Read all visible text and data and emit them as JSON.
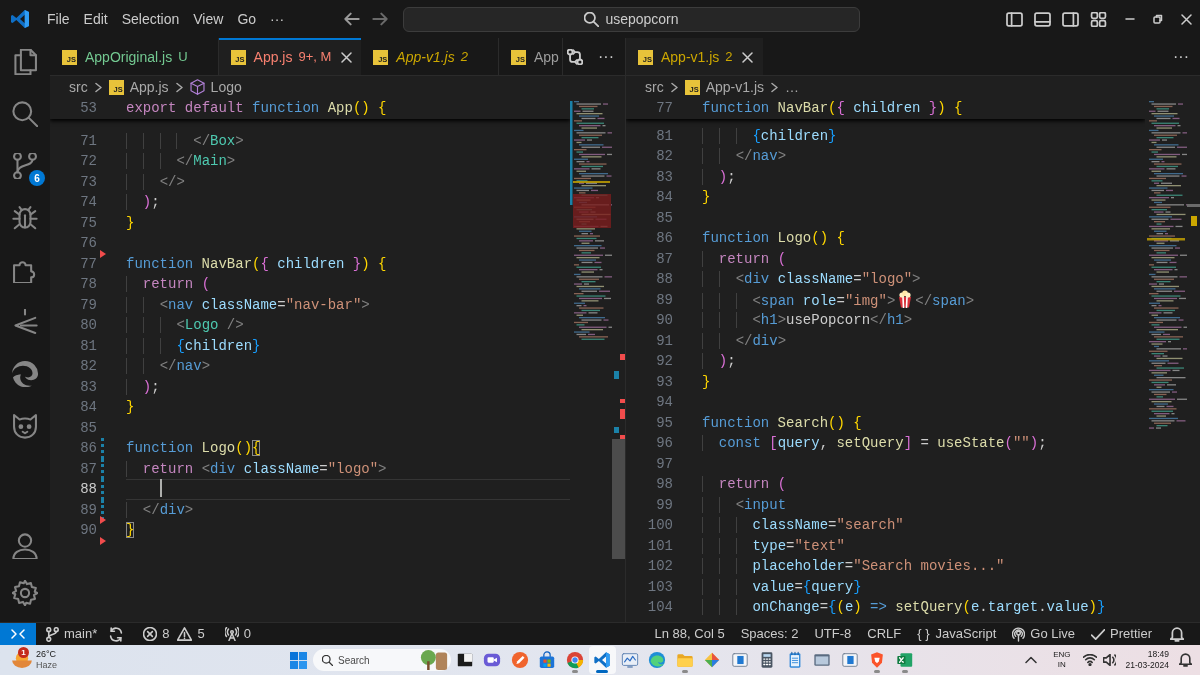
{
  "title_bar": {
    "menu": [
      "File",
      "Edit",
      "Selection",
      "View",
      "Go",
      "···"
    ],
    "command_center": "usepopcorn"
  },
  "activity_bar": {
    "items": [
      {
        "kind": "explorer"
      },
      {
        "kind": "search"
      },
      {
        "kind": "source_control",
        "badge": "6"
      },
      {
        "kind": "debug"
      },
      {
        "kind": "extensions"
      },
      {
        "kind": "arrow"
      },
      {
        "kind": "swirl"
      },
      {
        "kind": "cat"
      }
    ],
    "bottom": [
      {
        "kind": "account"
      },
      {
        "kind": "settings"
      }
    ]
  },
  "editors": [
    {
      "focused": true,
      "tabs": [
        {
          "icon_text": "JS",
          "name": "AppOriginal.js",
          "decoration": "U",
          "color": "#73c991",
          "selected": false,
          "preview": false
        },
        {
          "icon_text": "JS",
          "name": "App.js",
          "decoration": "9+, M",
          "color": "#f88070",
          "selected": true,
          "preview": false
        },
        {
          "icon_text": "JS",
          "name": "App-v1.js",
          "decoration": "2",
          "color": "#cca700",
          "selected": false,
          "preview": true
        },
        {
          "icon_text": "JS",
          "name": "App",
          "color": "#9d9d9d",
          "selected": false,
          "preview": false
        }
      ],
      "actions": [
        {
          "kind": "compare"
        },
        {
          "kind": "more",
          "label": "···"
        }
      ],
      "breadcrumbs": [
        {
          "kind": "folder",
          "label": "src"
        },
        {
          "kind": "file",
          "icon_text": "JS",
          "label": "App.js"
        },
        {
          "kind": "symbol",
          "label": "Logo"
        }
      ],
      "sticky_line": {
        "number": "53",
        "tokens": [
          {
            "text": "export",
            "kind": "keyword"
          },
          {
            "text": " default",
            "kind": "keyword"
          },
          {
            "text": " function",
            "kind": "storage"
          },
          {
            "text": " App",
            "kind": "function"
          },
          {
            "text": "()",
            "kind": "bracket1"
          },
          {
            "text": " {",
            "kind": "bracket1"
          }
        ]
      },
      "lines": [
        {
          "number": "71",
          "current": false,
          "modified": false,
          "deleted": false,
          "tokens": [
            {
              "text": "        </",
              "kind": "punct"
            },
            {
              "text": "Box",
              "kind": "component"
            },
            {
              "text": ">",
              "kind": "punct"
            }
          ]
        },
        {
          "number": "72",
          "current": false,
          "modified": false,
          "deleted": false,
          "tokens": [
            {
              "text": "      </",
              "kind": "punct"
            },
            {
              "text": "Main",
              "kind": "component"
            },
            {
              "text": ">",
              "kind": "punct"
            }
          ]
        },
        {
          "number": "73",
          "current": false,
          "modified": false,
          "deleted": false,
          "tokens": [
            {
              "text": "    </>",
              "kind": "punct"
            }
          ]
        },
        {
          "number": "74",
          "current": false,
          "modified": false,
          "deleted": false,
          "tokens": [
            {
              "text": "  )",
              "kind": "bracket2"
            },
            {
              "text": ";",
              "kind": "plain"
            }
          ]
        },
        {
          "number": "75",
          "current": false,
          "modified": false,
          "deleted": false,
          "tokens": [
            {
              "text": "}",
              "kind": "bracket1"
            }
          ]
        },
        {
          "number": "76",
          "current": false,
          "modified": false,
          "deleted": true
        },
        {
          "number": "77",
          "current": false,
          "modified": false,
          "deleted": false,
          "tokens": [
            {
              "text": "function",
              "kind": "storage"
            },
            {
              "text": " NavBar",
              "kind": "function"
            },
            {
              "text": "(",
              "kind": "bracket1"
            },
            {
              "text": "{",
              "kind": "bracket2"
            },
            {
              "text": " children",
              "kind": "variable"
            },
            {
              "text": " }",
              "kind": "bracket2"
            },
            {
              "text": ")",
              "kind": "bracket1"
            },
            {
              "text": " {",
              "kind": "bracket1"
            }
          ]
        },
        {
          "number": "78",
          "current": false,
          "modified": false,
          "deleted": false,
          "tokens": [
            {
              "text": "  return",
              "kind": "keyword"
            },
            {
              "text": " (",
              "kind": "bracket2"
            }
          ]
        },
        {
          "number": "79",
          "current": false,
          "modified": false,
          "deleted": false,
          "tokens": [
            {
              "text": "    <",
              "kind": "punct"
            },
            {
              "text": "nav",
              "kind": "tag"
            },
            {
              "text": " className",
              "kind": "attr"
            },
            {
              "text": "=",
              "kind": "plain"
            },
            {
              "text": "\"nav-bar\"",
              "kind": "string"
            },
            {
              "text": ">",
              "kind": "punct"
            }
          ]
        },
        {
          "number": "80",
          "current": false,
          "modified": false,
          "deleted": false,
          "tokens": [
            {
              "text": "      <",
              "kind": "punct"
            },
            {
              "text": "Logo",
              "kind": "component"
            },
            {
              "text": " />",
              "kind": "punct"
            }
          ]
        },
        {
          "number": "81",
          "current": false,
          "modified": false,
          "deleted": false,
          "tokens": [
            {
              "text": "      {",
              "kind": "bracket3"
            },
            {
              "text": "children",
              "kind": "variable"
            },
            {
              "text": "}",
              "kind": "bracket3"
            }
          ]
        },
        {
          "number": "82",
          "current": false,
          "modified": false,
          "deleted": false,
          "tokens": [
            {
              "text": "    </",
              "kind": "punct"
            },
            {
              "text": "nav",
              "kind": "tag"
            },
            {
              "text": ">",
              "kind": "punct"
            }
          ]
        },
        {
          "number": "83",
          "current": false,
          "modified": false,
          "deleted": false,
          "tokens": [
            {
              "text": "  )",
              "kind": "bracket2"
            },
            {
              "text": ";",
              "kind": "plain"
            }
          ]
        },
        {
          "number": "84",
          "current": false,
          "modified": false,
          "deleted": false,
          "tokens": [
            {
              "text": "}",
              "kind": "bracket1"
            }
          ]
        },
        {
          "number": "85",
          "current": false,
          "modified": false,
          "deleted": false
        },
        {
          "number": "86",
          "current": false,
          "modified": true,
          "deleted": false,
          "tokens": [
            {
              "text": "function",
              "kind": "storage"
            },
            {
              "text": " Logo",
              "kind": "function"
            },
            {
              "text": "()",
              "kind": "bracket1"
            },
            {
              "text": "{",
              "kind": "matched"
            }
          ]
        },
        {
          "number": "87",
          "current": false,
          "modified": true,
          "deleted": false,
          "tokens": [
            {
              "text": "  return",
              "kind": "keyword"
            },
            {
              "text": " <",
              "kind": "punct"
            },
            {
              "text": "div",
              "kind": "tag"
            },
            {
              "text": " className",
              "kind": "attr"
            },
            {
              "text": "=",
              "kind": "plain"
            },
            {
              "text": "\"logo\"",
              "kind": "string"
            },
            {
              "text": ">",
              "kind": "punct"
            }
          ]
        },
        {
          "number": "88",
          "current": true,
          "modified": true,
          "deleted": false
        },
        {
          "number": "89",
          "current": false,
          "modified": true,
          "deleted": true,
          "tokens": [
            {
              "text": "  </",
              "kind": "punct"
            },
            {
              "text": "div",
              "kind": "tag"
            },
            {
              "text": ">",
              "kind": "punct"
            }
          ]
        },
        {
          "number": "90",
          "current": false,
          "modified": false,
          "deleted": true,
          "tokens": [
            {
              "text": "}",
              "kind": "matched"
            }
          ]
        }
      ]
    },
    {
      "focused": false,
      "tabs": [
        {
          "icon_text": "JS",
          "name": "App-v1.js",
          "decoration": "2",
          "color": "#cca700",
          "selected": true,
          "preview": false
        }
      ],
      "actions": [
        {
          "kind": "more",
          "label": "···"
        }
      ],
      "breadcrumbs": [
        {
          "kind": "folder",
          "label": "src"
        },
        {
          "kind": "file",
          "icon_text": "JS",
          "label": "App-v1.js"
        },
        {
          "kind": "more",
          "label": "…"
        }
      ],
      "sticky_line": {
        "number": "77",
        "tokens": [
          {
            "text": "function",
            "kind": "storage"
          },
          {
            "text": " NavBar",
            "kind": "function"
          },
          {
            "text": "(",
            "kind": "bracket1"
          },
          {
            "text": "{",
            "kind": "bracket2"
          },
          {
            "text": " children",
            "kind": "variable"
          },
          {
            "text": " }",
            "kind": "bracket2"
          },
          {
            "text": ")",
            "kind": "bracket1"
          },
          {
            "text": " {",
            "kind": "bracket1"
          }
        ]
      },
      "lines": [
        {
          "number": "81",
          "current": false,
          "tokens": [
            {
              "text": "      {",
              "kind": "bracket3"
            },
            {
              "text": "children",
              "kind": "variable"
            },
            {
              "text": "}",
              "kind": "bracket3"
            }
          ]
        },
        {
          "number": "82",
          "current": false,
          "tokens": [
            {
              "text": "    </",
              "kind": "punct"
            },
            {
              "text": "nav",
              "kind": "tag"
            },
            {
              "text": ">",
              "kind": "punct"
            }
          ]
        },
        {
          "number": "83",
          "current": false,
          "tokens": [
            {
              "text": "  )",
              "kind": "bracket2"
            },
            {
              "text": ";",
              "kind": "plain"
            }
          ]
        },
        {
          "number": "84",
          "current": false,
          "tokens": [
            {
              "text": "}",
              "kind": "bracket1"
            }
          ]
        },
        {
          "number": "85",
          "current": false
        },
        {
          "number": "86",
          "current": false,
          "tokens": [
            {
              "text": "function",
              "kind": "storage"
            },
            {
              "text": " Logo",
              "kind": "function"
            },
            {
              "text": "()",
              "kind": "bracket1"
            },
            {
              "text": " {",
              "kind": "bracket1"
            }
          ]
        },
        {
          "number": "87",
          "current": false,
          "tokens": [
            {
              "text": "  return",
              "kind": "keyword"
            },
            {
              "text": " (",
              "kind": "bracket2"
            }
          ]
        },
        {
          "number": "88",
          "current": false,
          "tokens": [
            {
              "text": "    <",
              "kind": "punct"
            },
            {
              "text": "div",
              "kind": "tag"
            },
            {
              "text": " className",
              "kind": "attr"
            },
            {
              "text": "=",
              "kind": "plain"
            },
            {
              "text": "\"logo\"",
              "kind": "string"
            },
            {
              "text": ">",
              "kind": "punct"
            }
          ]
        },
        {
          "number": "89",
          "current": false,
          "tokens": [
            {
              "text": "      <",
              "kind": "punct"
            },
            {
              "text": "span",
              "kind": "tag"
            },
            {
              "text": " role",
              "kind": "attr"
            },
            {
              "text": "=",
              "kind": "plain"
            },
            {
              "text": "\"img\"",
              "kind": "string"
            },
            {
              "text": ">",
              "kind": "punct"
            },
            {
              "kind": "emoji"
            },
            {
              "text": "</",
              "kind": "punct"
            },
            {
              "text": "span",
              "kind": "tag"
            },
            {
              "text": ">",
              "kind": "punct"
            }
          ]
        },
        {
          "number": "90",
          "current": false,
          "tokens": [
            {
              "text": "      <",
              "kind": "punct"
            },
            {
              "text": "h1",
              "kind": "tag"
            },
            {
              "text": ">",
              "kind": "punct"
            },
            {
              "text": "usePopcorn",
              "kind": "plain"
            },
            {
              "text": "</",
              "kind": "punct"
            },
            {
              "text": "h1",
              "kind": "tag"
            },
            {
              "text": ">",
              "kind": "punct"
            }
          ]
        },
        {
          "number": "91",
          "current": false,
          "tokens": [
            {
              "text": "    </",
              "kind": "punct"
            },
            {
              "text": "div",
              "kind": "tag"
            },
            {
              "text": ">",
              "kind": "punct"
            }
          ]
        },
        {
          "number": "92",
          "current": false,
          "tokens": [
            {
              "text": "  )",
              "kind": "bracket2"
            },
            {
              "text": ";",
              "kind": "plain"
            }
          ]
        },
        {
          "number": "93",
          "current": false,
          "tokens": [
            {
              "text": "}",
              "kind": "bracket1"
            }
          ]
        },
        {
          "number": "94",
          "current": false
        },
        {
          "number": "95",
          "current": false,
          "tokens": [
            {
              "text": "function",
              "kind": "storage"
            },
            {
              "text": " Search",
              "kind": "function"
            },
            {
              "text": "()",
              "kind": "bracket1"
            },
            {
              "text": " {",
              "kind": "bracket1"
            }
          ]
        },
        {
          "number": "96",
          "current": false,
          "tokens": [
            {
              "text": "  const",
              "kind": "storage"
            },
            {
              "text": " [",
              "kind": "bracket2"
            },
            {
              "text": "query",
              "kind": "variable"
            },
            {
              "text": ",",
              "kind": "plain"
            },
            {
              "text": " setQuery",
              "kind": "function"
            },
            {
              "text": "]",
              "kind": "bracket2"
            },
            {
              "text": " =",
              "kind": "plain"
            },
            {
              "text": " useState",
              "kind": "function"
            },
            {
              "text": "(",
              "kind": "bracket2"
            },
            {
              "text": "\"\"",
              "kind": "string"
            },
            {
              "text": ")",
              "kind": "bracket2"
            },
            {
              "text": ";",
              "kind": "plain"
            }
          ]
        },
        {
          "number": "97",
          "current": false
        },
        {
          "number": "98",
          "current": false,
          "tokens": [
            {
              "text": "  return",
              "kind": "keyword"
            },
            {
              "text": " (",
              "kind": "bracket2"
            }
          ]
        },
        {
          "number": "99",
          "current": false,
          "tokens": [
            {
              "text": "    <",
              "kind": "punct"
            },
            {
              "text": "input",
              "kind": "tag"
            }
          ]
        },
        {
          "number": "100",
          "current": false,
          "tokens": [
            {
              "text": "      className",
              "kind": "attr"
            },
            {
              "text": "=",
              "kind": "plain"
            },
            {
              "text": "\"search\"",
              "kind": "string"
            }
          ]
        },
        {
          "number": "101",
          "current": false,
          "tokens": [
            {
              "text": "      type",
              "kind": "attr"
            },
            {
              "text": "=",
              "kind": "plain"
            },
            {
              "text": "\"text\"",
              "kind": "string"
            }
          ]
        },
        {
          "number": "102",
          "current": false,
          "tokens": [
            {
              "text": "      placeholder",
              "kind": "attr"
            },
            {
              "text": "=",
              "kind": "plain"
            },
            {
              "text": "\"Search movies...\"",
              "kind": "string"
            }
          ]
        },
        {
          "number": "103",
          "current": false,
          "tokens": [
            {
              "text": "      value",
              "kind": "attr"
            },
            {
              "text": "=",
              "kind": "plain"
            },
            {
              "text": "{",
              "kind": "bracket3"
            },
            {
              "text": "query",
              "kind": "variable"
            },
            {
              "text": "}",
              "kind": "bracket3"
            }
          ]
        },
        {
          "number": "104",
          "current": false,
          "tokens": [
            {
              "text": "      onChange",
              "kind": "attr"
            },
            {
              "text": "=",
              "kind": "plain"
            },
            {
              "text": "{",
              "kind": "bracket3"
            },
            {
              "text": "(",
              "kind": "bracket1"
            },
            {
              "text": "e",
              "kind": "variable"
            },
            {
              "text": ")",
              "kind": "bracket1"
            },
            {
              "text": " =>",
              "kind": "storage"
            },
            {
              "text": " setQuery",
              "kind": "function"
            },
            {
              "text": "(",
              "kind": "bracket1"
            },
            {
              "text": "e",
              "kind": "variable"
            },
            {
              "text": ".",
              "kind": "plain"
            },
            {
              "text": "target",
              "kind": "variable"
            },
            {
              "text": ".",
              "kind": "plain"
            },
            {
              "text": "value",
              "kind": "variable"
            },
            {
              "text": ")",
              "kind": "bracket1"
            },
            {
              "text": "}",
              "kind": "bracket3"
            }
          ]
        }
      ]
    }
  ],
  "status_bar": {
    "left": [
      {
        "kind": "remote"
      },
      {
        "kind": "branch",
        "label": "main*"
      },
      {
        "kind": "sync"
      },
      {
        "kind": "problems",
        "errors": "8",
        "warnings": "5"
      },
      {
        "kind": "ports",
        "label": "0"
      }
    ],
    "right": [
      {
        "kind": "text",
        "label": "Ln 88, Col 5"
      },
      {
        "kind": "text",
        "label": "Spaces: 2"
      },
      {
        "kind": "text",
        "label": "UTF-8"
      },
      {
        "kind": "text",
        "label": "CRLF"
      },
      {
        "kind": "language",
        "glyph": "{ }",
        "label": "JavaScript"
      },
      {
        "kind": "live",
        "label": "Go Live"
      },
      {
        "kind": "check",
        "label": "Prettier"
      },
      {
        "kind": "bell"
      }
    ]
  },
  "taskbar": {
    "weather": {
      "badge": "1",
      "temperature": "26°C",
      "condition": "Haze"
    },
    "search": {
      "placeholder": "Search"
    },
    "apps": [
      {
        "kind": "tiles",
        "selected": false,
        "running": false
      },
      {
        "kind": "video",
        "selected": false,
        "running": false
      },
      {
        "kind": "pen",
        "selected": false,
        "running": false
      },
      {
        "kind": "bag",
        "selected": false,
        "running": false
      },
      {
        "kind": "tricolor",
        "selected": false,
        "running": true
      },
      {
        "kind": "ribbon",
        "selected": true,
        "running": true
      },
      {
        "kind": "chart",
        "selected": false,
        "running": false
      },
      {
        "kind": "swirl",
        "selected": false,
        "running": false
      },
      {
        "kind": "folder",
        "selected": false,
        "running": true
      },
      {
        "kind": "diamond",
        "selected": false,
        "running": false
      },
      {
        "kind": "panel",
        "selected": false,
        "running": false
      },
      {
        "kind": "calculator",
        "selected": false,
        "running": false
      },
      {
        "kind": "notepad",
        "selected": false,
        "running": false
      },
      {
        "kind": "window",
        "selected": false,
        "running": false
      },
      {
        "kind": "panel",
        "selected": false,
        "running": false
      },
      {
        "kind": "shield",
        "selected": false,
        "running": true
      },
      {
        "kind": "spreadsheet",
        "selected": false,
        "running": true
      }
    ],
    "tray": {
      "language": "ENG",
      "region": "IN",
      "time": "18:49",
      "date": "21-03-2024"
    }
  }
}
